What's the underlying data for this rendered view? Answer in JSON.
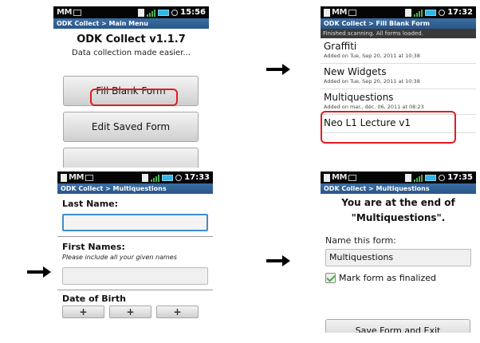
{
  "status_bar": {
    "gmail_icons": "MM",
    "phone1_time": "15:56",
    "phone2_time": "17:32",
    "phone3_time": "17:33",
    "phone4_time": "17:35"
  },
  "screen1": {
    "titlebar": "ODK Collect > Main Menu",
    "app_title": "ODK Collect v1.1.7",
    "tagline": "Data collection made easier...",
    "fill_blank_form": "Fill Blank Form",
    "edit_saved_form": "Edit Saved Form"
  },
  "screen2": {
    "titlebar": "ODK Collect > Fill Blank Form",
    "info": "Finished scanning. All forms loaded.",
    "forms": [
      {
        "name": "Graffiti",
        "added": "Added on Tue, Sep 20, 2011 at 10:38"
      },
      {
        "name": "New Widgets",
        "added": "Added on Tue, Sep 20, 2011 at 10:38"
      },
      {
        "name": "Multiquestions",
        "added": "Added on mar., déc. 06, 2011 at 08:23"
      },
      {
        "name": "Neo L1 Lecture v1",
        "added": ""
      }
    ]
  },
  "screen3": {
    "titlebar": "ODK Collect > Multiquestions",
    "last_name_label": "Last Name:",
    "first_names_label": "First Names:",
    "first_names_hint": "Please include all your given names",
    "dob_label": "Date of Birth",
    "plus": "+"
  },
  "screen4": {
    "titlebar": "ODK Collect > Multiquestions",
    "end_line1": "You are at the end of",
    "end_line2": "\"Multiquestions\".",
    "name_label": "Name this form:",
    "name_value": "Multiquestions",
    "finalize_label": "Mark form as finalized",
    "save_button": "Save Form and Exit"
  },
  "colors": {
    "titlebar": "#2a5686",
    "highlight": "#e11b22",
    "focus": "#3d8ed0",
    "battery": "#33b5e5"
  }
}
